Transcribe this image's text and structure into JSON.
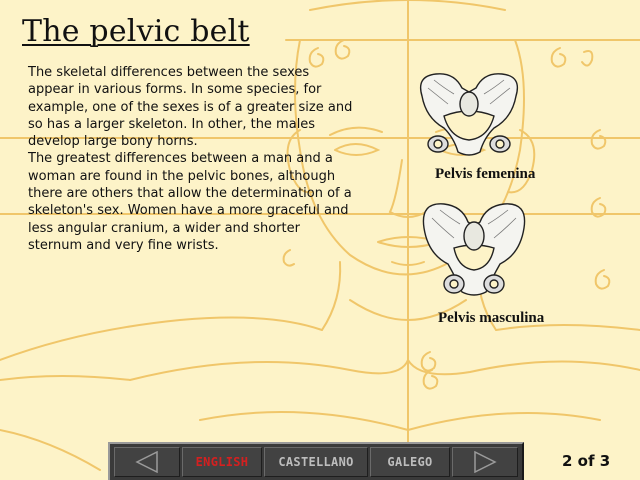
{
  "title": "The pelvic belt",
  "body": {
    "paragraph1": "The skeletal differences between the sexes appear in various forms. In some species, for example, one of the sexes is of a greater size and so has a larger skeleton. In other, the males develop large bony horns.",
    "paragraph2": "The greatest differences between a man and a woman are found in the pelvic bones, although there are others that allow the determination of a skeleton's sex. Women have a more graceful and less angular cranium, a wider and shorter sternum and very fine wrists."
  },
  "figures": {
    "female_caption": "Pelvis femenina",
    "male_caption": "Pelvis masculina"
  },
  "nav": {
    "prev_icon": "left-triangle-arrow",
    "next_icon": "right-triangle-arrow",
    "languages": [
      "ENGLISH",
      "CASTELLANO",
      "GALEGO"
    ],
    "active_language": "ENGLISH",
    "active_color": "#d42020"
  },
  "page_counter": "2 of 3",
  "colors": {
    "background": "#fdf3c8",
    "sketch_lines": "#f0c66a",
    "navbar": "#3a3a3a"
  }
}
